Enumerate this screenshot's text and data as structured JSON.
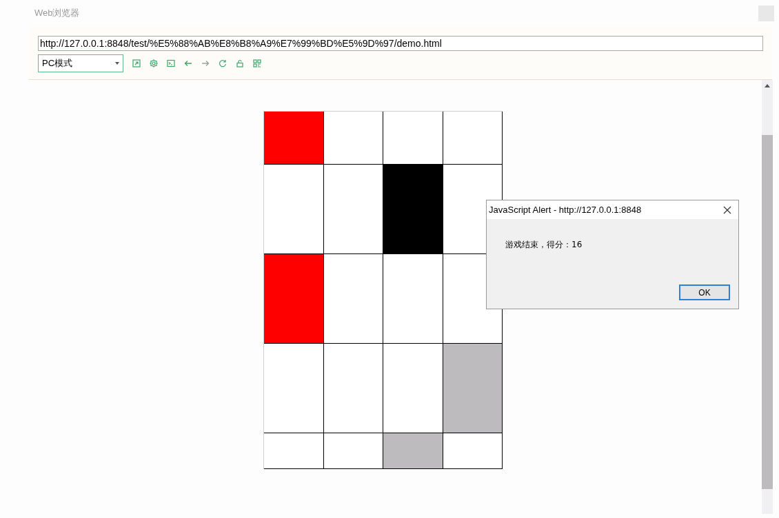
{
  "window": {
    "title": "Web浏览器"
  },
  "address_bar": {
    "value": "http://127.0.0.1:8848/test/%E5%88%AB%E8%B8%A9%E7%99%BD%E5%9D%97/demo.html"
  },
  "mode_select": {
    "value": "PC模式"
  },
  "toolbar": [
    {
      "kind": "open-external"
    },
    {
      "kind": "settings"
    },
    {
      "kind": "console"
    },
    {
      "kind": "back"
    },
    {
      "kind": "forward"
    },
    {
      "kind": "reload"
    },
    {
      "kind": "lock"
    },
    {
      "kind": "qr-code"
    }
  ],
  "grid": {
    "rows": [
      {
        "cells": [
          {
            "color": "#ff0000"
          },
          {
            "color": "#ffffff"
          },
          {
            "color": "#ffffff"
          },
          {
            "color": "#ffffff"
          }
        ]
      },
      {
        "cells": [
          {
            "color": "#ffffff"
          },
          {
            "color": "#ffffff"
          },
          {
            "color": "#000000"
          },
          {
            "color": "#ffffff"
          }
        ]
      },
      {
        "cells": [
          {
            "color": "#ff0000"
          },
          {
            "color": "#ffffff"
          },
          {
            "color": "#ffffff"
          },
          {
            "color": "#ffffff"
          }
        ]
      },
      {
        "cells": [
          {
            "color": "#ffffff"
          },
          {
            "color": "#ffffff"
          },
          {
            "color": "#ffffff"
          },
          {
            "color": "#bdbbbe"
          }
        ]
      },
      {
        "cells": [
          {
            "color": "#ffffff"
          },
          {
            "color": "#ffffff"
          },
          {
            "color": "#bdbbbe"
          },
          {
            "color": "#ffffff"
          }
        ]
      }
    ]
  },
  "alert": {
    "title": "JavaScript Alert - http://127.0.0.1:8848",
    "message": "游戏结束，得分：16",
    "button": "OK"
  }
}
